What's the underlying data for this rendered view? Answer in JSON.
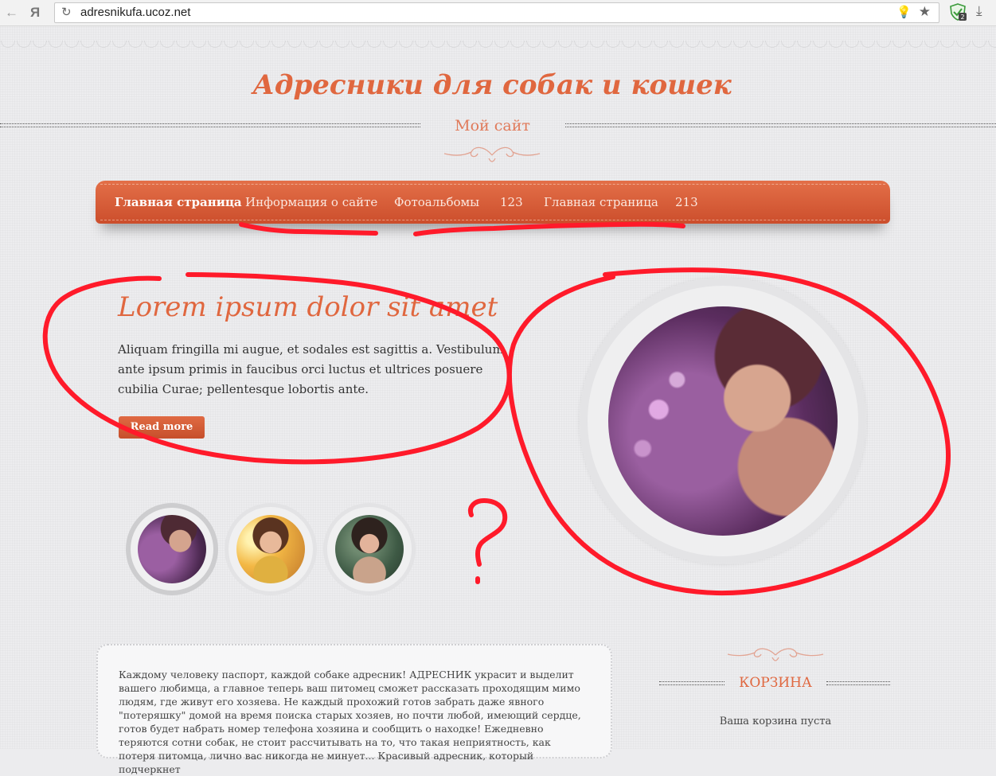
{
  "browser": {
    "url": "adresnikufa.ucoz.net",
    "back_icon": "←",
    "yandex_icon": "Я",
    "reload_icon": "↻",
    "bulb_icon": "💡",
    "star_icon": "★",
    "download_icon": "⤓",
    "extension_badge": "2"
  },
  "header": {
    "site_title": "Адресники для собак и кошек",
    "subtitle": "Мой сайт"
  },
  "menu": {
    "items": [
      {
        "label": "Главная страница"
      },
      {
        "label": "Информация о сайте"
      },
      {
        "label": "Фотоальбомы"
      },
      {
        "label": "123"
      },
      {
        "label": "Главная страница"
      },
      {
        "label": "213"
      }
    ]
  },
  "hero": {
    "title": "Lorem ipsum dolor sit amet",
    "text": "Aliquam fringilla mi augue, et sodales est sagittis a. Vestibulum ante ipsum primis in faucibus orci luctus et ultrices posuere cubilia Curae; pellentesque lobortis ante.",
    "button_label": "Read more"
  },
  "annotation": {
    "question_mark": "?"
  },
  "content": {
    "intro": "Каждому человеку паспорт, каждой собаке адресник! АДРЕСНИК украсит и выделит вашего любимца, а главное теперь ваш питомец сможет рассказать проходящим мимо людям, где живут его хозяева. Не каждый прохожий готов забрать даже явного \"потеряшку\" домой на время поиска старых хозяев, но почти любой, имеющий сердце, готов будет набрать номер телефона хозяина и сообщить о находке! Ежедневно теряются сотни собак, не стоит рассчитывать на то, что такая неприятность, как потеря питомца, лично вас никогда не минует... Красивый адресник, который подчеркнет"
  },
  "sidebar": {
    "cart_title": "КОРЗИНА",
    "cart_empty": "Ваша корзина пуста"
  },
  "colors": {
    "accent": "#e0673f",
    "annotation_red": "#ff1a2a"
  }
}
